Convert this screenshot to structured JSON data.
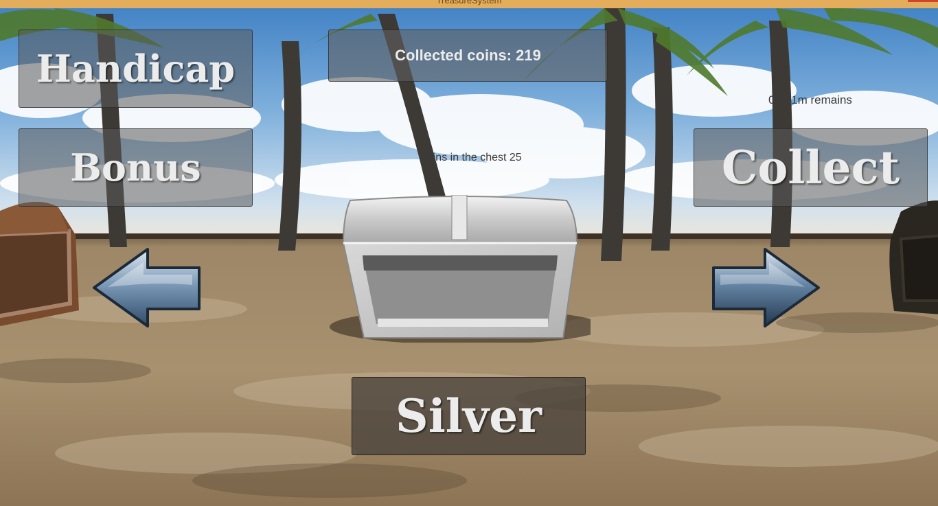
{
  "window": {
    "title": "TreasureSystem"
  },
  "buttons": {
    "handicap": "Handicap",
    "bonus": "Bonus",
    "collect": "Collect",
    "chest_type": "Silver"
  },
  "coins": {
    "label": "Collected coins:",
    "value": "219"
  },
  "timer": {
    "text": "02:41m remains"
  },
  "chest": {
    "text": "Coins in the chest 25"
  },
  "icons": {
    "left": "arrow-left-icon",
    "right": "arrow-right-icon",
    "chest": "treasure-chest-icon"
  },
  "colors": {
    "titlebar": "#e4ad5c",
    "panel": "#5a5a5a",
    "button_text": "#ececec",
    "arrow": "#3a5a7a"
  }
}
